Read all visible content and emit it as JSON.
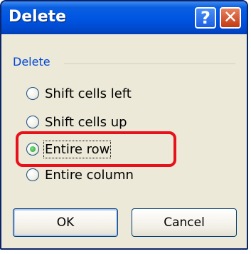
{
  "window": {
    "title": "Delete",
    "help_glyph": "?",
    "close_glyph": "✕"
  },
  "group": {
    "legend": "Delete"
  },
  "options": [
    {
      "label": "Shift cells left",
      "selected": false
    },
    {
      "label": "Shift cells up",
      "selected": false
    },
    {
      "label": "Entire row",
      "selected": true
    },
    {
      "label": "Entire column",
      "selected": false
    }
  ],
  "buttons": {
    "ok": "OK",
    "cancel": "Cancel"
  },
  "colors": {
    "title_bar": "#0054e3",
    "accent_text": "#0046d5",
    "highlight": "#e8101a",
    "dialog_bg": "#ece9d8"
  }
}
